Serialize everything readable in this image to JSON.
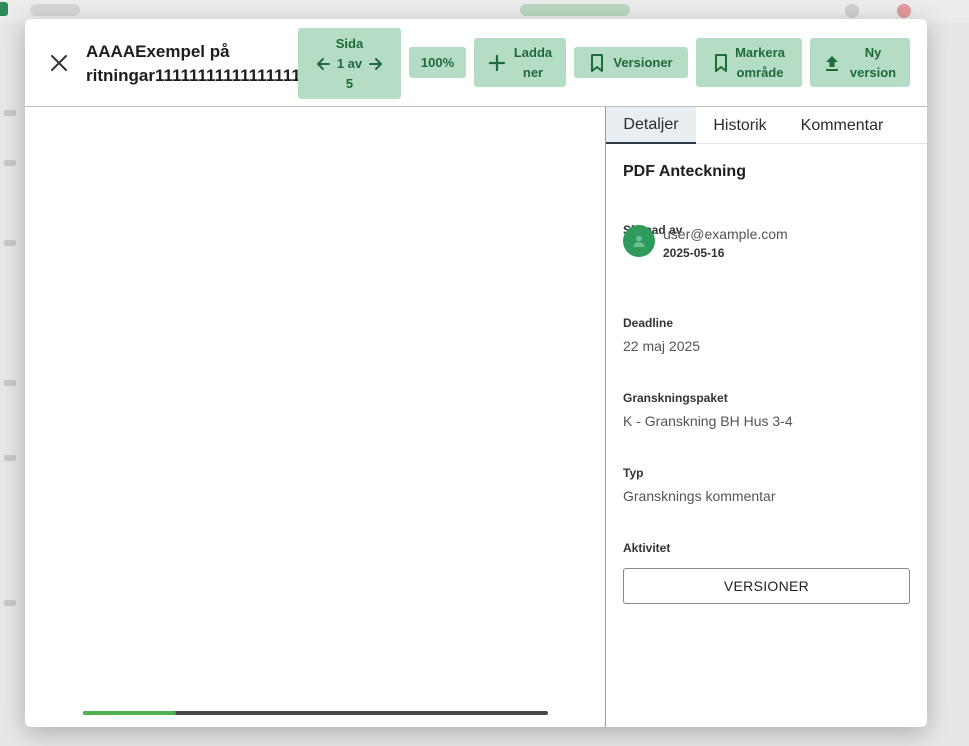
{
  "document": {
    "title_line1": "AAAAExempel på",
    "title_line2": "ritningar11111111111111111"
  },
  "toolbar": {
    "page_label": "Sida",
    "page_current": "1 av",
    "page_total": "5",
    "zoom": "100%",
    "download_line1": "Ladda",
    "download_line2": "ner",
    "versions": "Versioner",
    "mark_line1": "Markera",
    "mark_line2": "område",
    "newver_line1": "Ny",
    "newver_line2": "version"
  },
  "viewer": {
    "scroll_fraction": 0.2
  },
  "panel": {
    "tabs": [
      {
        "label": "Detaljer",
        "active": true
      },
      {
        "label": "Historik",
        "active": false
      },
      {
        "label": "Kommentar",
        "active": false
      }
    ],
    "title": "PDF Anteckning",
    "created_by_label": "Skapad av",
    "user_email": "user@example.com",
    "created_date": "2025-05-16",
    "deadline_label": "Deadline",
    "deadline_value": "22 maj 2025",
    "package_label": "Granskningspaket",
    "package_value": "K - Granskning BH Hus 3-4",
    "type_label": "Typ",
    "type_value": "Gransknings kommentar",
    "activity_label": "Aktivitet",
    "versions_button": "VERSIONER"
  },
  "colors": {
    "accent_bg": "#b5dcc4",
    "accent_text": "#1f6a3c",
    "avatar": "#2e9a5c",
    "scroll_fill": "#4caf50"
  },
  "icons": [
    "close-icon",
    "arrow-left-icon",
    "arrow-right-icon",
    "plus-icon",
    "bookmark-icon",
    "upload-icon",
    "person-icon"
  ]
}
